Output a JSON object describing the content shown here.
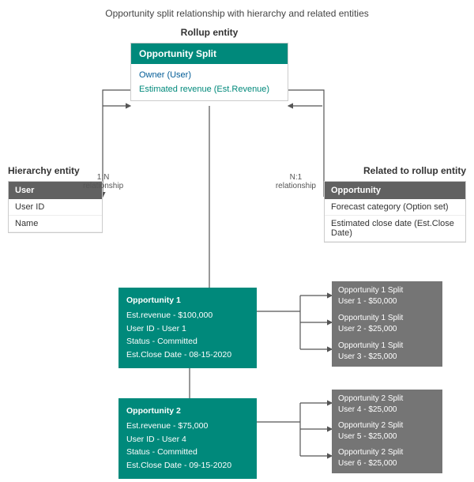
{
  "page": {
    "title": "Opportunity split relationship with hierarchy and related entities",
    "rollup_label": "Rollup entity",
    "hierarchy_label": "Hierarchy entity",
    "related_label": "Related to rollup entity"
  },
  "rollup_box": {
    "header": "Opportunity Split",
    "fields": [
      "Owner (User)",
      "Estimated revenue (Est.Revenue)"
    ]
  },
  "hierarchy_box": {
    "header": "User",
    "fields": [
      "User ID",
      "Name"
    ]
  },
  "related_box": {
    "header": "Opportunity",
    "fields": [
      "Forecast category (Option set)",
      "Estimated close date (Est.Close Date)"
    ]
  },
  "rel_1n": {
    "line1": "1:N",
    "line2": "relationship"
  },
  "rel_n1": {
    "line1": "N:1",
    "line2": "relationship"
  },
  "opportunity1": {
    "title": "Opportunity 1",
    "fields": [
      "Est.revenue - $100,000",
      "User ID - User 1",
      "Status - Committed",
      "Est.Close Date - 08-15-2020"
    ]
  },
  "opportunity2": {
    "title": "Opportunity 2",
    "fields": [
      "Est.revenue - $75,000",
      "User ID - User 4",
      "Status - Committed",
      "Est.Close Date - 09-15-2020"
    ]
  },
  "splits1": [
    {
      "line1": "Opportunity 1 Split",
      "line2": "User 1 - $50,000"
    },
    {
      "line1": "Opportunity 1 Split",
      "line2": "User 2 - $25,000"
    },
    {
      "line1": "Opportunity 1 Split",
      "line2": "User 3 - $25,000"
    }
  ],
  "splits2": [
    {
      "line1": "Opportunity 2 Split",
      "line2": "User 4 - $25,000"
    },
    {
      "line1": "Opportunity 2 Split",
      "line2": "User 5 - $25,000"
    },
    {
      "line1": "Opportunity 2 Split",
      "line2": "User 6 - $25,000"
    }
  ]
}
